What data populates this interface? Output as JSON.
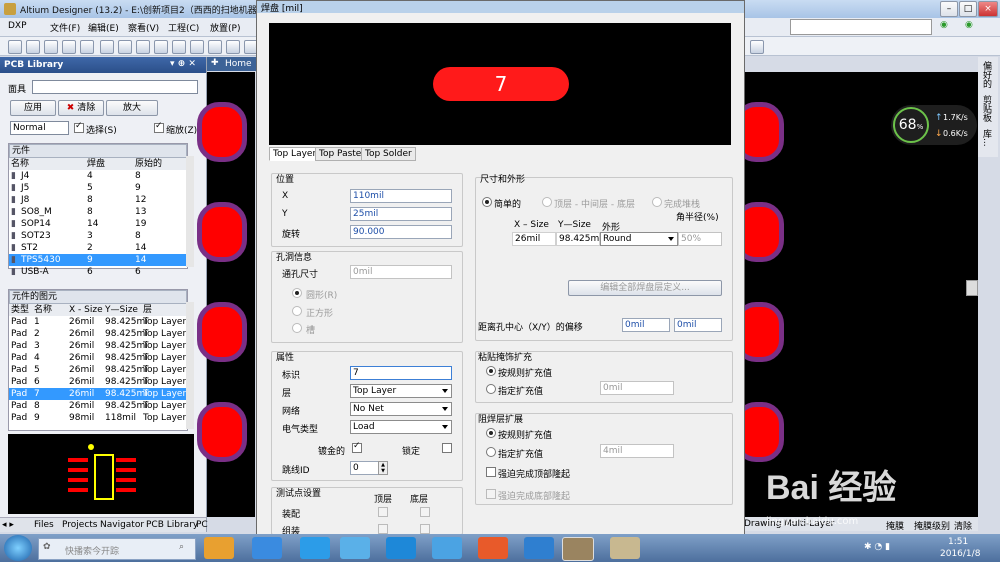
{
  "app": {
    "title": "Altium Designer (13.2) - E:\\创新项目2（西西的扫地机器人",
    "menu": [
      "DXP",
      "文件(F)",
      "编辑(E)",
      "察看(V)",
      "工程(C)",
      "放置(P)"
    ],
    "home_tab": "Home"
  },
  "panel": {
    "title": "PCB Library",
    "mask_label": "面具",
    "apply_btn": "应用",
    "clear_btn": "清除",
    "zoom_btn": "放大",
    "normal": "Normal",
    "select_chk": "选择(S)",
    "zoom_chk": "缩放(Z)",
    "components_title": "元件",
    "comp_headers": [
      "名称",
      "焊盘",
      "原始的"
    ],
    "components": [
      [
        "J4",
        "4",
        "8"
      ],
      [
        "J5",
        "5",
        "9"
      ],
      [
        "J8",
        "8",
        "12"
      ],
      [
        "SO8_M",
        "8",
        "13"
      ],
      [
        "SOP14",
        "14",
        "19"
      ],
      [
        "SOT23",
        "3",
        "8"
      ],
      [
        "ST2",
        "2",
        "14"
      ],
      [
        "TPS5430",
        "9",
        "14"
      ],
      [
        "USB-A",
        "6",
        "6"
      ]
    ],
    "prims_title": "元件的图元",
    "prim_headers": [
      "类型",
      "名称",
      "X - Size",
      "Y—Size",
      "层"
    ],
    "prims": [
      [
        "Pad",
        "1",
        "26mil",
        "98.425mi",
        "Top Layer"
      ],
      [
        "Pad",
        "2",
        "26mil",
        "98.425mi",
        "Top Layer"
      ],
      [
        "Pad",
        "3",
        "26mil",
        "98.425mi",
        "Top Layer"
      ],
      [
        "Pad",
        "4",
        "26mil",
        "98.425mi",
        "Top Layer"
      ],
      [
        "Pad",
        "5",
        "26mil",
        "98.425mi",
        "Top Layer"
      ],
      [
        "Pad",
        "6",
        "26mil",
        "98.425mi",
        "Top Layer"
      ],
      [
        "Pad",
        "7",
        "26mil",
        "98.425mi",
        "Top Layer"
      ],
      [
        "Pad",
        "8",
        "26mil",
        "98.425mi",
        "Top Layer"
      ],
      [
        "Pad",
        "9",
        "98mil",
        "118mil",
        "Top Layer"
      ]
    ],
    "bottom_tabs": [
      "Files",
      "Projects",
      "Navigator",
      "PCB Library",
      "PC"
    ]
  },
  "right": {
    "side_tabs": [
      "偏好的",
      "剪贴板",
      "库..."
    ],
    "speed_pct": "68",
    "speed_unit": "%",
    "up": "1.7K/s",
    "down": "0.6K/s",
    "bottom_tabs": [
      "Drawing",
      "Multi-Layer",
      "掩膜",
      "掩膜级别",
      "清除"
    ]
  },
  "dialog": {
    "title": "焊盘 [mil]",
    "pad_label": "7",
    "tabs": [
      "Top Layer",
      "Top Paste",
      "Top Solder"
    ],
    "position": {
      "title": "位置",
      "x_label": "X",
      "x": "110mil",
      "y_label": "Y",
      "y": "25mil",
      "rot_label": "旋转",
      "rot": "90.000"
    },
    "hole": {
      "title": "孔洞信息",
      "size_label": "通孔尺寸",
      "size": "0mil",
      "round": "圆形(R)",
      "square": "正方形",
      "slot": "槽"
    },
    "props": {
      "title": "属性",
      "id_label": "标识",
      "id": "7",
      "layer_label": "层",
      "layer": "Top Layer",
      "net_label": "网络",
      "net": "No Net",
      "etype_label": "电气类型",
      "etype": "Load",
      "plated": "镀金的",
      "locked": "锁定",
      "jumper_label": "跳线ID",
      "jumper": "0"
    },
    "testpoint": {
      "title": "测试点设置",
      "top": "顶层",
      "bottom": "底层",
      "assembly": "装配",
      "group": "组装"
    },
    "size_shape": {
      "title": "尺寸和外形",
      "simple": "简单的",
      "top_mid_bot": "顶层 - 中间层 - 底层",
      "full_stack": "完成堆栈",
      "corner_label": "角半径(%)",
      "xsize_h": "X – Size",
      "ysize_h": "Y—Size",
      "shape_h": "外形",
      "xsize": "26mil",
      "ysize": "98.425mil",
      "shape": "Round",
      "corner": "50%",
      "edit_all": "编辑全部焊盘层定义...",
      "offset_label": "距离孔中心（X/Y）的偏移",
      "off_x": "0mil",
      "off_y": "0mil"
    },
    "paste": {
      "title": "粘贴掩饰扩充",
      "rule": "按规则扩充值",
      "specify": "指定扩充值",
      "val": "0mil"
    },
    "solder": {
      "title": "阻焊层扩展",
      "rule": "按规则扩充值",
      "specify": "指定扩充值",
      "val": "4mil",
      "force_top": "强迫完成顶部隆起",
      "force_bottom": "强迫完成底部隆起"
    }
  },
  "taskbar": {
    "search": "快播索今开踪",
    "time": "1:51",
    "date": "2016/1/8",
    "watermark": "Bai 经验",
    "watermark_sub": "jingyan.baidu.com"
  }
}
